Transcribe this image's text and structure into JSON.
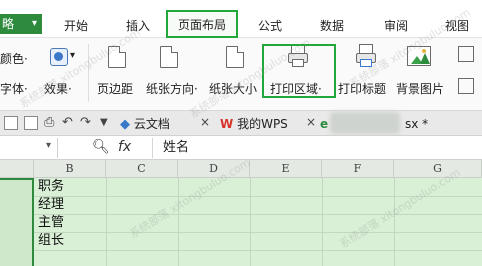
{
  "app": {
    "menu_button_label": "略"
  },
  "menu_tabs": [
    "开始",
    "插入",
    "页面布局",
    "公式",
    "数据",
    "审阅",
    "视图"
  ],
  "ribbon": {
    "row1_left": "颜色·",
    "row2_left": "字体·",
    "effects": "效果·",
    "margins": "页边距",
    "orientation": "纸张方向·",
    "size": "纸张大小",
    "print_area": "打印区域·",
    "print_titles": "打印标题",
    "background": "背景图片"
  },
  "doc_tabs": {
    "cloud": "云文档",
    "wps": "我的WPS",
    "current_suffix": "sx *"
  },
  "formula_bar": {
    "fx_label": "fx",
    "content": "姓名"
  },
  "columns": [
    "B",
    "C",
    "D",
    "E",
    "F",
    "G"
  ],
  "cells": [
    "职务",
    "经理",
    "主管",
    "组长"
  ],
  "watermark": "系统部落"
}
